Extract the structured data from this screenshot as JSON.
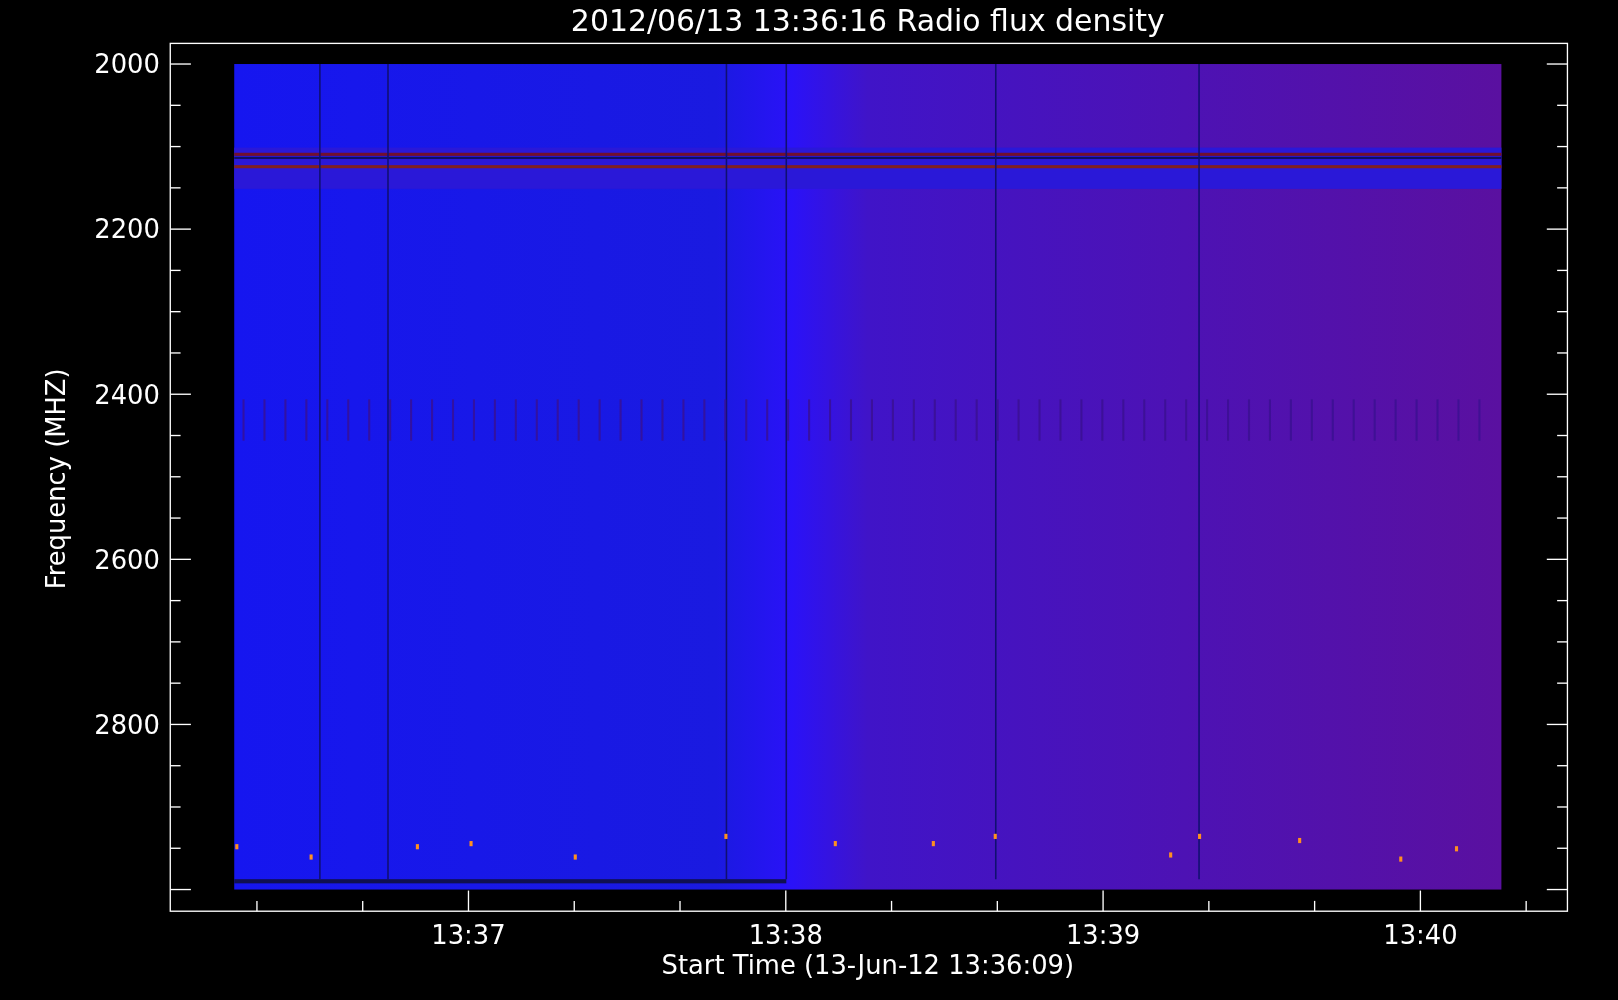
{
  "title": "2012/06/13 13:36:16 Radio flux density",
  "y_axis": {
    "label": "Frequency (MHZ)",
    "ticks": [
      "2000",
      "2200",
      "2400",
      "2600",
      "2800"
    ]
  },
  "x_axis": {
    "label": "Start Time (13-Jun-12 13:36:09)",
    "ticks": [
      "13:37",
      "13:38",
      "13:39",
      "13:40"
    ]
  }
}
